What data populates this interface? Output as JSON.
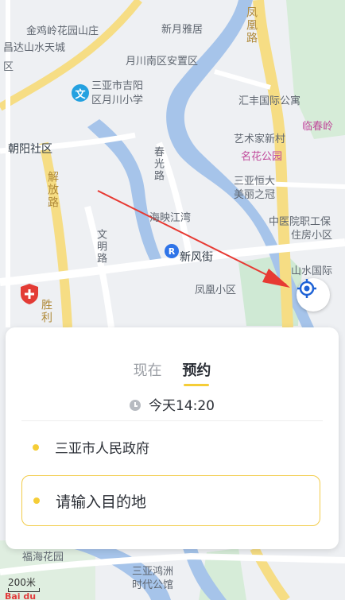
{
  "map": {
    "labels": {
      "l1": "金鸡岭花园山庄",
      "l2": "新月雅居",
      "l3": "昌达山水天城",
      "l4": "区",
      "l5": "月川南区安置区",
      "l6": "三亚市吉阳",
      "l7": "区月川小学",
      "l8": "汇丰国际公寓",
      "l9": "临春岭",
      "l10": "朝阳社区",
      "l11": "艺术家新村",
      "l12": "名花公园",
      "l13": "三亚恒大",
      "l14": "美丽之冠",
      "l15": "春光路",
      "l16": "解放路",
      "l17": "海映江湾",
      "l18": "中医院职工保",
      "l19": "住房小区",
      "l20": "文明路",
      "l21": "新风街",
      "l22": "凤凰小区",
      "l23": "山水国际",
      "l24": "胜利",
      "l25": "凤凰路",
      "l26": "福海花园",
      "l27": "三亚鸿洲",
      "l28": "时代公馆"
    },
    "poi_wen": "文",
    "poi_r": "R",
    "scale": "200米",
    "logo": "Bai du"
  },
  "panel": {
    "tab_now": "现在",
    "tab_reserve": "预约",
    "time": "今天14:20",
    "origin": "三亚市人民政府",
    "destination_placeholder": "请输入目的地"
  },
  "colors": {
    "accent": "#f5cd37",
    "river": "#a6c4ea",
    "road": "#f6dd84",
    "park": "#cfe9d4"
  }
}
